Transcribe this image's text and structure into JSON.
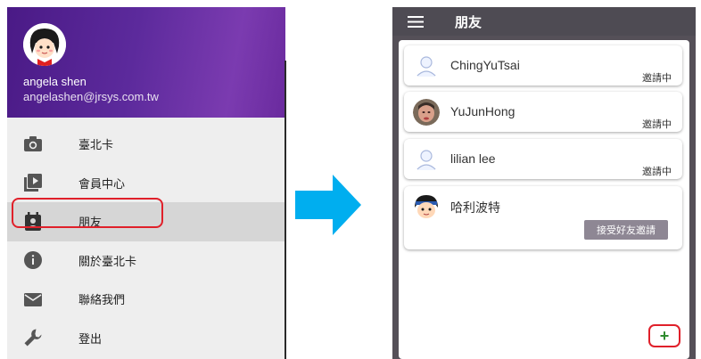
{
  "drawer": {
    "user_name": "angela shen",
    "user_email": "angelashen@jrsys.com.tw",
    "items": [
      {
        "label": "臺北卡",
        "icon": "camera-icon"
      },
      {
        "label": "會員中心",
        "icon": "video-library-icon"
      },
      {
        "label": "朋友",
        "icon": "contacts-icon",
        "active": true
      },
      {
        "label": "關於臺北卡",
        "icon": "info-icon"
      },
      {
        "label": "聯絡我們",
        "icon": "mail-icon"
      },
      {
        "label": "登出",
        "icon": "wrench-icon"
      }
    ]
  },
  "friends_screen": {
    "title": "朋友",
    "friends": [
      {
        "name": "ChingYuTsai",
        "status": "邀請中",
        "avatar": "default-person-avatar"
      },
      {
        "name": "YuJunHong",
        "status": "邀請中",
        "avatar": "photo-avatar"
      },
      {
        "name": "lilian lee",
        "status": "邀請中",
        "avatar": "default-person-avatar"
      },
      {
        "name": "哈利波特",
        "action_label": "接受好友邀請",
        "avatar": "cartoon-avatar"
      }
    ],
    "add_button_label": "+"
  },
  "colors": {
    "drawer_header": "#5c2a9c",
    "highlight": "#e0202a",
    "arrow": "#00aeef",
    "accept_button": "#8e8794",
    "fab_plus": "#2e8b2e"
  }
}
